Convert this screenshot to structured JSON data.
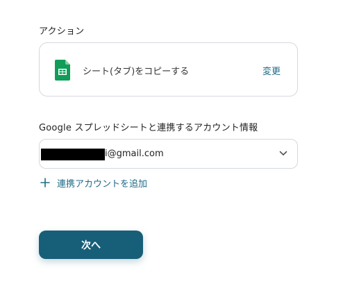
{
  "action_section": {
    "label": "アクション",
    "action_name": "シート(タブ)をコピーする",
    "change_label": "変更",
    "icon": "google-sheets-icon"
  },
  "account_section": {
    "label": "Google スプレッドシートと連携するアカウント情報",
    "selected_account": "i@gmail.com",
    "add_account_label": "連携アカウントを追加"
  },
  "next_button_label": "次へ",
  "colors": {
    "accent": "#1e6b85",
    "button": "#175f78",
    "sheets_green": "#0f9d58"
  }
}
